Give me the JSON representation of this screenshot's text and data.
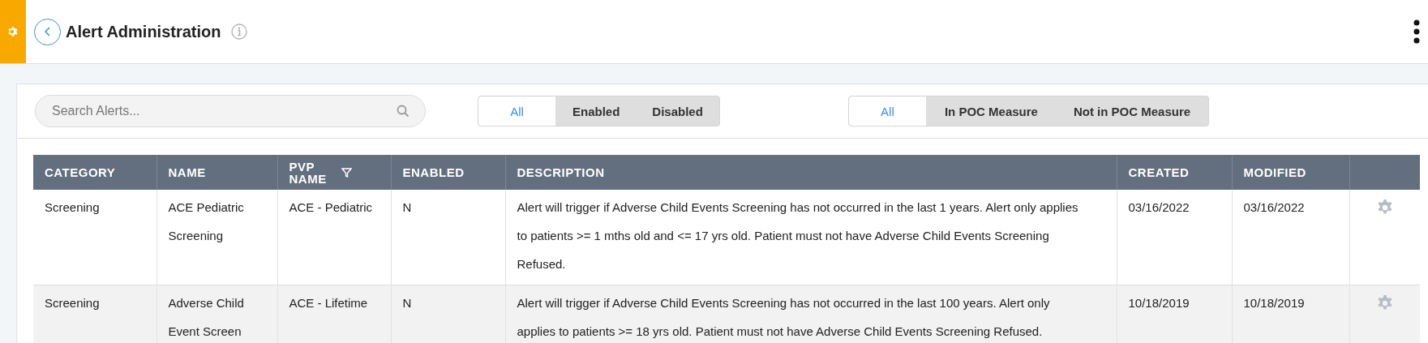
{
  "header": {
    "title": "Alert Administration"
  },
  "search": {
    "placeholder": "Search Alerts..."
  },
  "status_filter": [
    {
      "label": "All",
      "selected": true
    },
    {
      "label": "Enabled",
      "selected": false
    },
    {
      "label": "Disabled",
      "selected": false
    }
  ],
  "poc_filter": [
    {
      "label": "All",
      "selected": true
    },
    {
      "label": "In POC Measure",
      "selected": false
    },
    {
      "label": "Not in POC Measure",
      "selected": false
    }
  ],
  "table": {
    "columns": [
      {
        "label": "CATEGORY",
        "filter": false
      },
      {
        "label": "NAME",
        "filter": false
      },
      {
        "label": "PVP NAME",
        "filter": true
      },
      {
        "label": "ENABLED",
        "filter": false
      },
      {
        "label": "DESCRIPTION",
        "filter": false
      },
      {
        "label": "CREATED",
        "filter": false
      },
      {
        "label": "MODIFIED",
        "filter": false
      }
    ],
    "rows": [
      {
        "category": "Screening",
        "name": "ACE Pediatric Screening",
        "pvp_name": "ACE - Pediatric",
        "enabled": "N",
        "description": "Alert will trigger if Adverse Child Events Screening has not occurred in the last 1 years. Alert only applies to patients >= 1 mths old and <= 17 yrs old. Patient must not have Adverse Child Events Screening Refused.",
        "created": "03/16/2022",
        "modified": "03/16/2022"
      },
      {
        "category": "Screening",
        "name": "Adverse Child Event Screen",
        "pvp_name": "ACE - Lifetime",
        "enabled": "N",
        "description": "Alert will trigger if Adverse Child Events Screening has not occurred in the last 100 years. Alert only applies to patients >= 18 yrs old. Patient must not have Adverse Child Events Screening Refused.",
        "created": "10/18/2019",
        "modified": "10/18/2019"
      }
    ]
  }
}
